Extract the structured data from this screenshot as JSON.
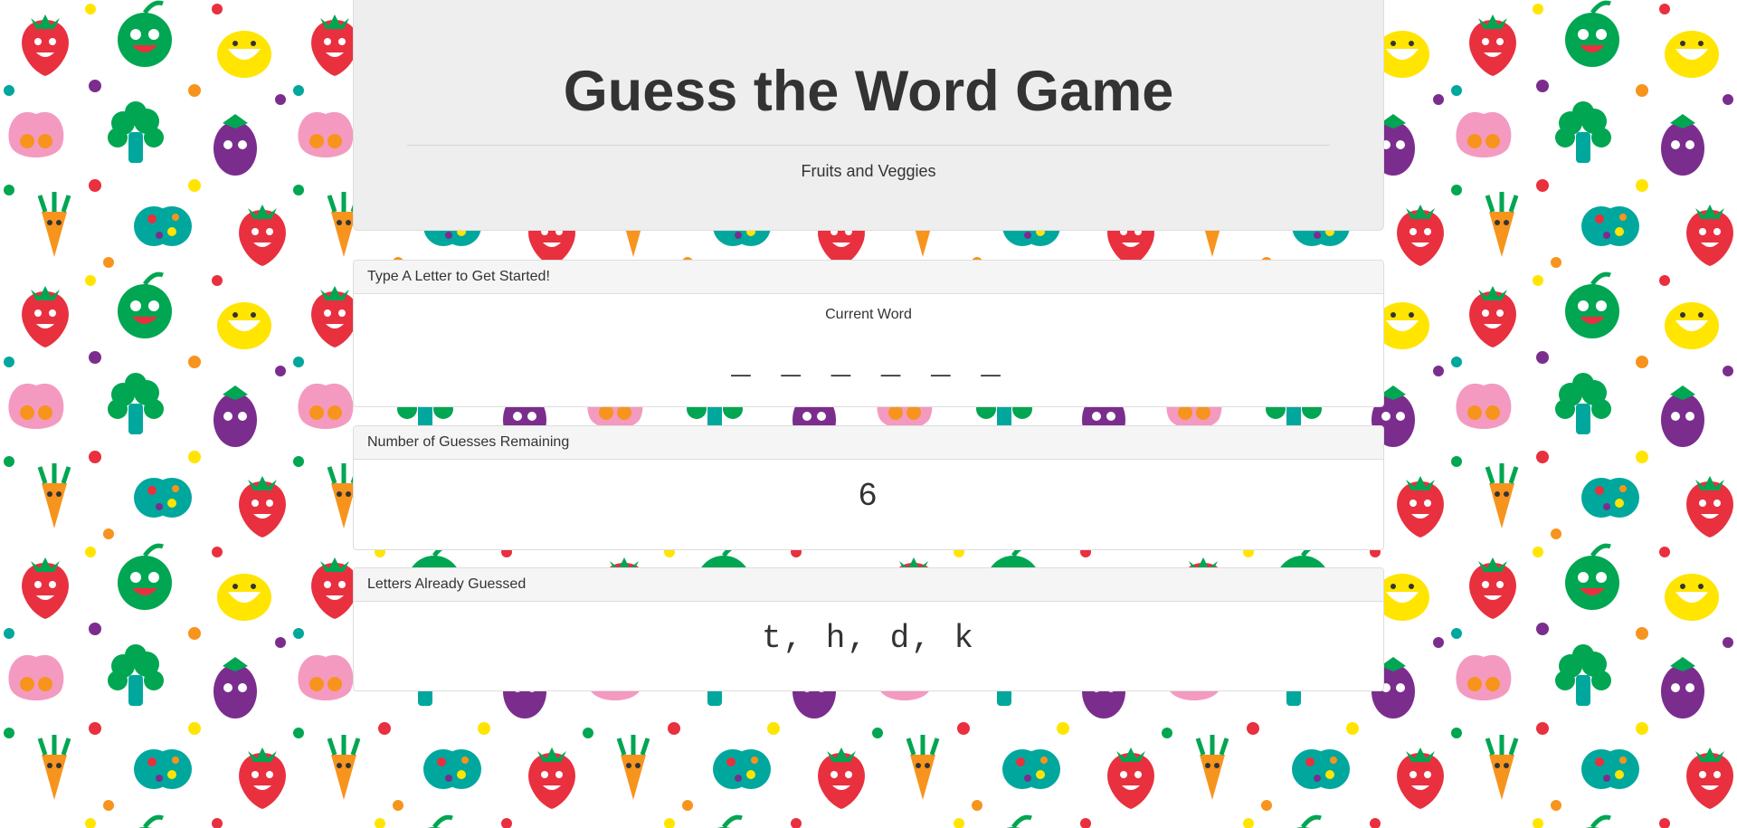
{
  "header": {
    "title": "Guess the Word Game",
    "subtitle": "Fruits and Veggies"
  },
  "word_panel": {
    "heading": "Type A Letter to Get Started!",
    "label": "Current Word",
    "value": "_ _ _ _ _ _"
  },
  "guesses_panel": {
    "heading": "Number of Guesses Remaining",
    "value": "6"
  },
  "letters_panel": {
    "heading": "Letters Already Guessed",
    "value": "t, h, d, k"
  },
  "colors": {
    "jumbotron_bg": "#eeeeee",
    "panel_heading_bg": "#f5f5f5",
    "text": "#333333",
    "pattern": [
      "#e8303f",
      "#f7941d",
      "#ffe500",
      "#00a651",
      "#00a79d",
      "#7b2d8e",
      "#f49ac1"
    ]
  },
  "background": {
    "theme": "fruits-and-veggies-pattern"
  }
}
